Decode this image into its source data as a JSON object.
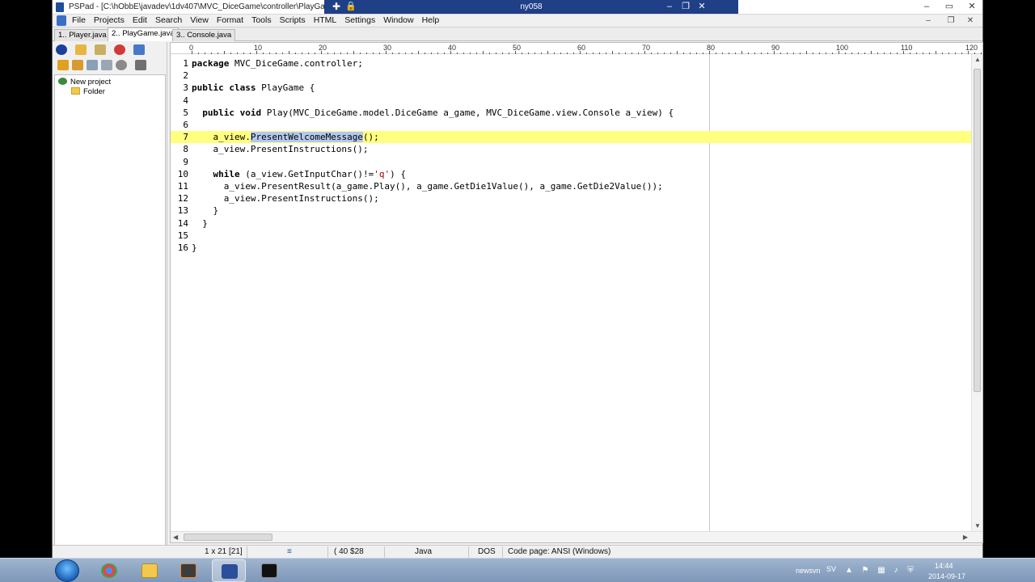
{
  "titlebar": {
    "title": "PSPad - [C:\\hObbE\\javadev\\1dv407\\MVC_DiceGame\\controller\\PlayGam",
    "remote_host": "ny058"
  },
  "menu": {
    "items": [
      "File",
      "Projects",
      "Edit",
      "Search",
      "View",
      "Format",
      "Tools",
      "Scripts",
      "HTML",
      "Settings",
      "Window",
      "Help"
    ]
  },
  "tabs": [
    {
      "label": "1.. Player.java"
    },
    {
      "label": "2.. PlayGame.java"
    },
    {
      "label": "3.. Console.java"
    }
  ],
  "project_tree": {
    "root": "New project",
    "child": "Folder"
  },
  "ruler": {
    "labels": [
      "0",
      "10",
      "20",
      "30",
      "40",
      "50",
      "60",
      "70",
      "80",
      "90",
      "100",
      "110",
      "120"
    ]
  },
  "code_lines": [
    {
      "num": "1",
      "text": "package MVC_DiceGame.controller;"
    },
    {
      "num": "2",
      "text": ""
    },
    {
      "num": "3",
      "text": "public class PlayGame {"
    },
    {
      "num": "4",
      "text": ""
    },
    {
      "num": "5",
      "text": "  public void Play(MVC_DiceGame.model.DiceGame a_game, MVC_DiceGame.view.Console a_view) {"
    },
    {
      "num": "6",
      "text": ""
    },
    {
      "num": "7",
      "text": "    a_view.PresentWelcomeMessage();"
    },
    {
      "num": "8",
      "text": "    a_view.PresentInstructions();"
    },
    {
      "num": "9",
      "text": ""
    },
    {
      "num": "10",
      "text": "    while (a_view.GetInputChar()!='q') {"
    },
    {
      "num": "11",
      "text": "      a_view.PresentResult(a_game.Play(), a_game.GetDie1Value(), a_game.GetDie2Value());"
    },
    {
      "num": "12",
      "text": "      a_view.PresentInstructions();"
    },
    {
      "num": "13",
      "text": "    }"
    },
    {
      "num": "14",
      "text": "  }"
    },
    {
      "num": "15",
      "text": ""
    },
    {
      "num": "16",
      "text": "}"
    }
  ],
  "status": {
    "position": "1 x 21  [21]",
    "chars": "(   40  $28",
    "language": "Java",
    "line_ending": "DOS",
    "code_page": "Code page: ANSI (Windows)"
  },
  "taskbar": {
    "tray_label": "newsvn",
    "lang": "SV",
    "time": "14:44",
    "date": "2014-09-17"
  },
  "colors": {
    "current_line": "#ffff80",
    "selection": "#b4c8ec",
    "remote_bar": "#1f3f86"
  }
}
